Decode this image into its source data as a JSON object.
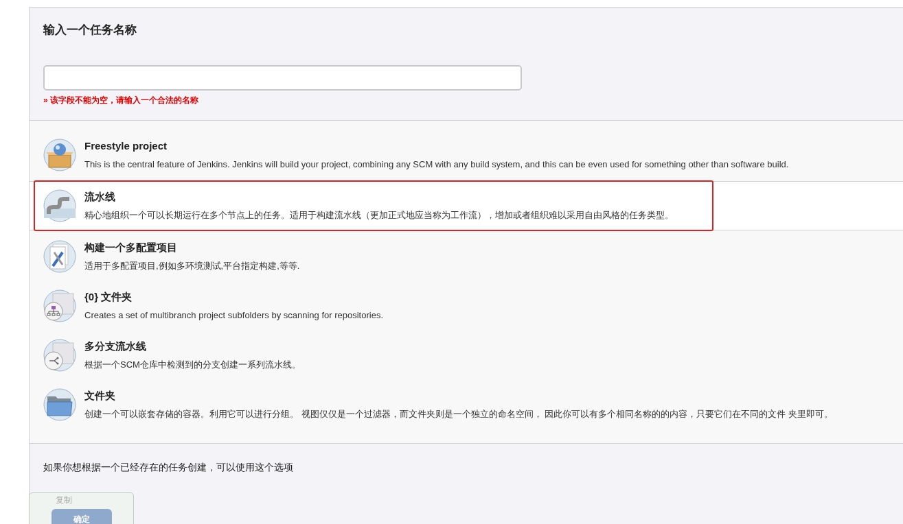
{
  "name_section": {
    "title": "输入一个任务名称",
    "error": "» 该字段不能为空，请输入一个合法的名称"
  },
  "job_types": [
    {
      "kind": "freestyle",
      "title": "Freestyle project",
      "description": "This is the central feature of Jenkins. Jenkins will build your project, combining any SCM with any build system, and this can be even used for something other than software build.",
      "selected": false
    },
    {
      "kind": "pipeline",
      "title": "流水线",
      "description": "精心地组织一个可以长期运行在多个节点上的任务。适用于构建流水线（更加正式地应当称为工作流），增加或者组织难以采用自由风格的任务类型。",
      "selected": true
    },
    {
      "kind": "matrix",
      "title": "构建一个多配置项目",
      "description": "适用于多配置项目,例如多环境测试,平台指定构建,等等.",
      "selected": false
    },
    {
      "kind": "org-folder",
      "title": "{0} 文件夹",
      "description": "Creates a set of multibranch project subfolders by scanning for repositories.",
      "selected": false
    },
    {
      "kind": "multibranch",
      "title": "多分支流水线",
      "description": "根据一个SCM仓库中检测到的分支创建一系列流水线。",
      "selected": false
    },
    {
      "kind": "folder",
      "title": "文件夹",
      "description": "创建一个可以嵌套存储的容器。利用它可以进行分组。 视图仅仅是一个过滤器，而文件夹则是一个独立的命名空间， 因此你可以有多个相同名称的的内容，只要它们在不同的文件 夹里即可。",
      "selected": false
    }
  ],
  "copy_section": {
    "hint": "如果你想根据一个已经存在的任务创建，可以使用这个选项",
    "copy_label": "复制"
  },
  "footer": {
    "ok_button": "确定"
  }
}
